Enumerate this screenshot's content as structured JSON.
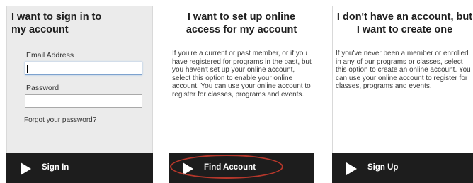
{
  "signin": {
    "title": "I want to sign in to my account",
    "email_label": "Email Address",
    "email_value": "",
    "password_label": "Password",
    "password_value": "",
    "forgot_link": "Forgot your password?",
    "button_label": "Sign In"
  },
  "setup": {
    "title": "I want to set up online access for my account",
    "description": "If you're a current or past member, or if you have registered for programs in the past, but you haven't set up your online account, select this option to enable your online account. You can use your online account to register for classes, programs and events.",
    "button_label": "Find Account"
  },
  "create": {
    "title": "I don't have an account, but I want to create one",
    "description": "If you've never been a member or enrolled in any of our programs or classes, select this option to create an online account. You can use your online account to register for classes, programs and events.",
    "button_label": "Sign Up"
  },
  "icons": {
    "action_arrow": "play-triangle-icon"
  },
  "colors": {
    "action_bar": "#1d1d1d",
    "highlight": "#b5372b",
    "signin_panel": "#ebebeb"
  }
}
